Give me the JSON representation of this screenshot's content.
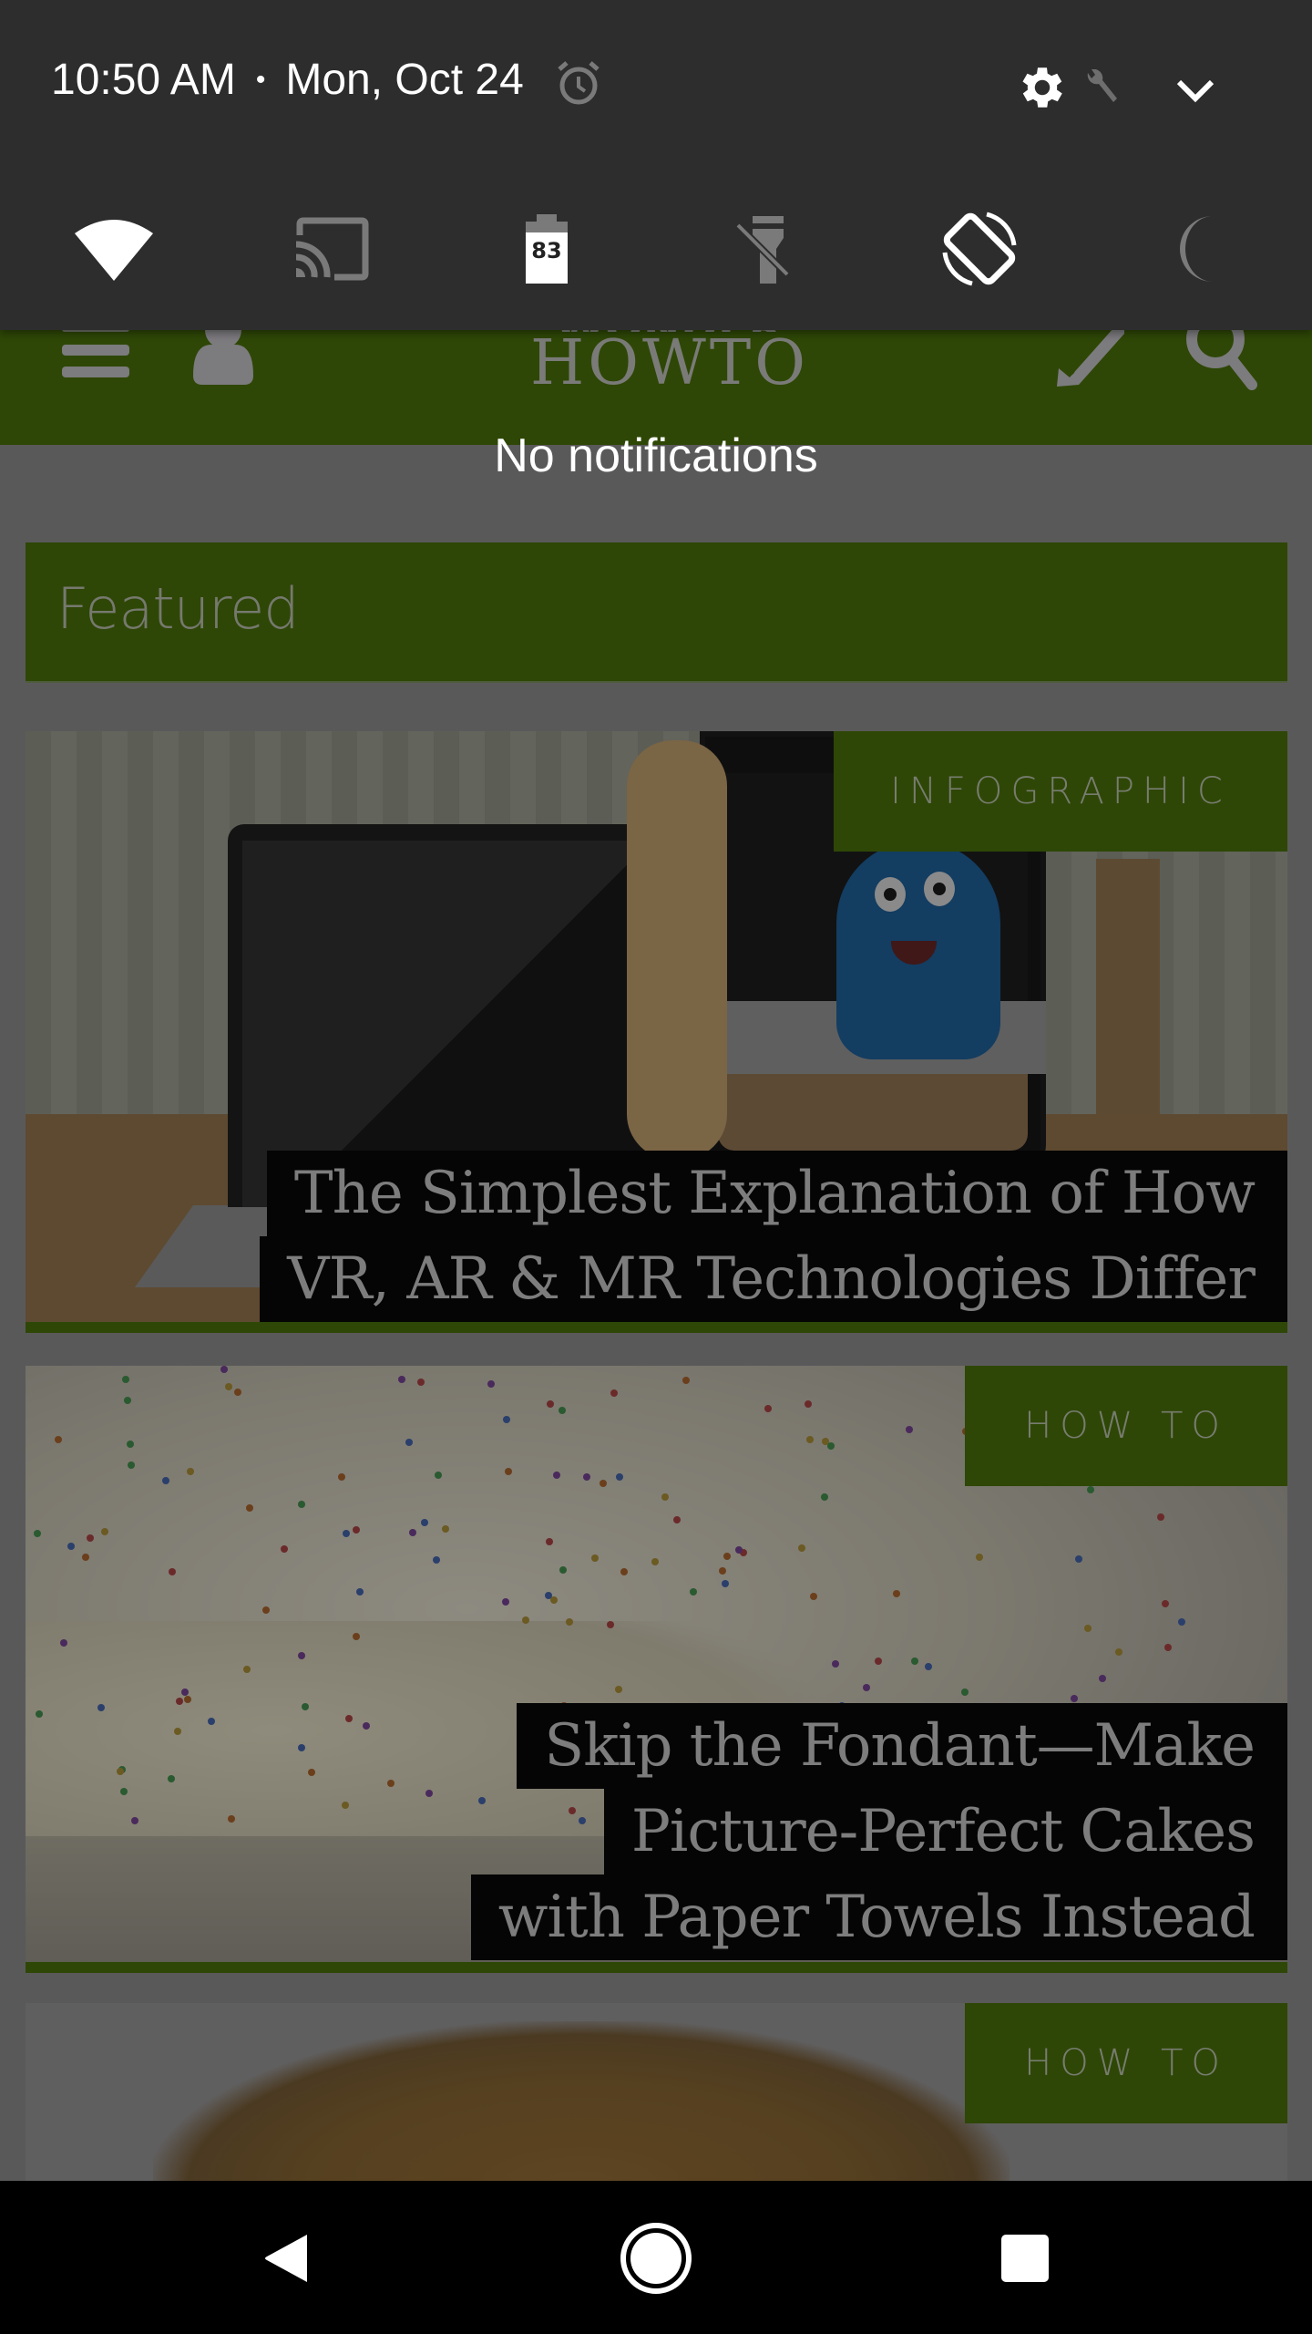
{
  "status_bar": {
    "time": "10:50 AM",
    "separator": "•",
    "date": "Mon, Oct 24",
    "icons": [
      "alarm-icon",
      "settings-gear-icon",
      "wrench-icon",
      "expand-chevron-icon"
    ]
  },
  "quick_settings": [
    {
      "name": "wifi",
      "icon": "wifi-icon",
      "active": true
    },
    {
      "name": "cast",
      "icon": "cast-icon",
      "active": false
    },
    {
      "name": "battery",
      "icon": "battery-icon",
      "active": true,
      "value": "83"
    },
    {
      "name": "flashlight",
      "icon": "flashlight-off-icon",
      "active": false
    },
    {
      "name": "auto-rotate",
      "icon": "screen-rotation-icon",
      "active": true
    },
    {
      "name": "do-not-disturb",
      "icon": "moon-icon",
      "active": false
    }
  ],
  "notifications": {
    "empty_text": "No notifications"
  },
  "app": {
    "logo_top": "WONDER",
    "logo_bottom": "HOWTO",
    "header_icons": [
      "menu-icon",
      "user-icon",
      "pencil-icon",
      "search-icon"
    ],
    "section_title": "Featured",
    "articles": [
      {
        "category": "INFOGRAPHIC",
        "title_lines": [
          "The Simplest Explanation of How",
          "VR, AR & MR Technologies Differ"
        ]
      },
      {
        "category": "HOW TO",
        "title_lines": [
          "Skip the Fondant—Make",
          "Picture-Perfect Cakes",
          "with Paper Towels Instead"
        ]
      },
      {
        "category": "HOW TO",
        "title_lines": []
      }
    ]
  },
  "colors": {
    "shade_bg": "#2d2d2d",
    "brand_green_dimmed": "#2e4706",
    "scrim_bg": "#5a595a",
    "active_icon": "#ffffff",
    "inactive_icon": "#7a7a7a"
  },
  "navbar": {
    "buttons": [
      "back-icon",
      "home-icon",
      "recents-icon"
    ]
  }
}
